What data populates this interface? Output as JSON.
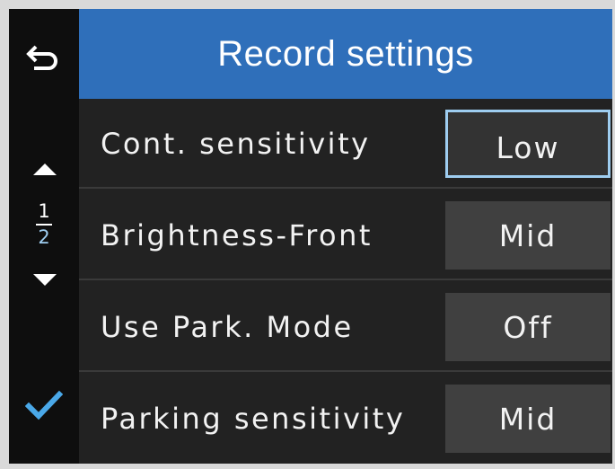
{
  "header": {
    "title": "Record settings"
  },
  "sidebar": {
    "page_current": "1",
    "page_total": "2",
    "icons": [
      "back-arrow-icon",
      "triangle-up-icon",
      "triangle-down-icon",
      "checkmark-icon"
    ]
  },
  "settings": [
    {
      "label": "Cont. sensitivity",
      "value": "Low",
      "selected": true
    },
    {
      "label": "Brightness-Front",
      "value": "Mid",
      "selected": false
    },
    {
      "label": "Use Park. Mode",
      "value": "Off",
      "selected": false
    },
    {
      "label": "Parking sensitivity",
      "value": "Mid",
      "selected": false
    }
  ],
  "colors": {
    "header_bg": "#2f6fba",
    "accent": "#9ecdf0",
    "checkmark": "#4aa8e8",
    "background": "#222222"
  }
}
